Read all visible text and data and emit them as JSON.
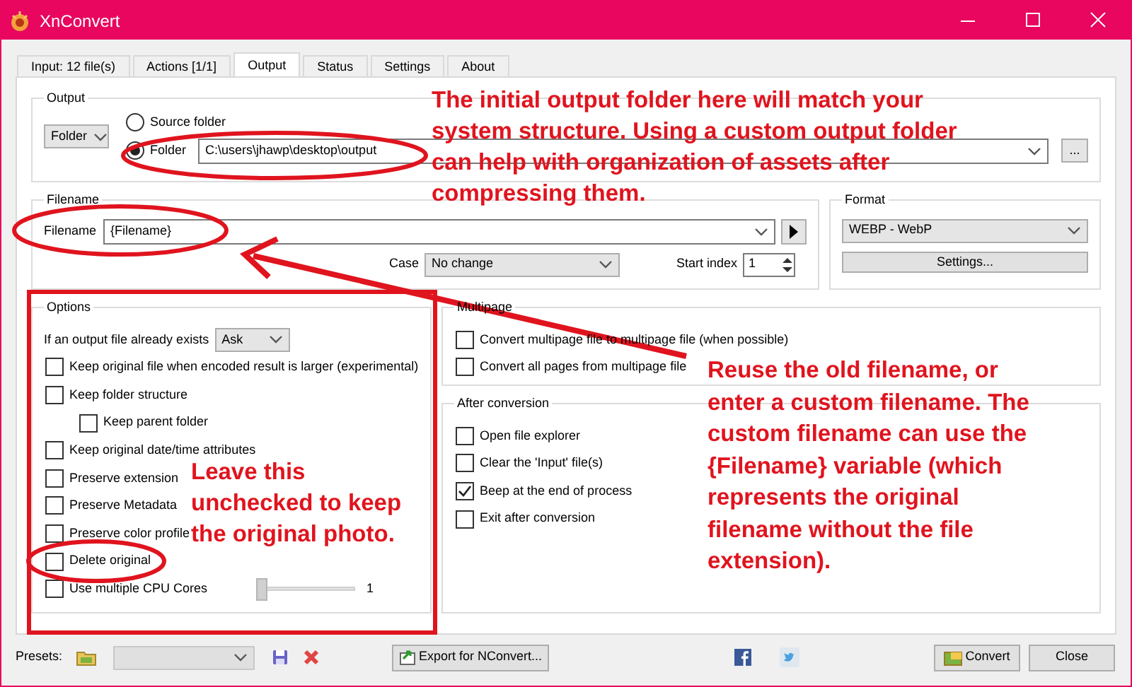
{
  "window": {
    "title": "XnConvert"
  },
  "tabs": [
    {
      "label": "Input: 12 file(s)",
      "selected": false
    },
    {
      "label": "Actions [1/1]",
      "selected": false
    },
    {
      "label": "Output",
      "selected": true
    },
    {
      "label": "Status",
      "selected": false
    },
    {
      "label": "Settings",
      "selected": false
    },
    {
      "label": "About",
      "selected": false
    }
  ],
  "output": {
    "title": "Output",
    "mode": "Folder",
    "radios": [
      {
        "label": "Source folder",
        "selected": false
      },
      {
        "label": "Folder",
        "selected": true
      }
    ],
    "path": "C:\\users\\jhawp\\desktop\\output",
    "browse": "..."
  },
  "filename": {
    "title": "Filename",
    "label": "Filename",
    "value": "{Filename}",
    "case_label": "Case",
    "case_value": "No change",
    "start_label": "Start index",
    "start_value": "1"
  },
  "format": {
    "title": "Format",
    "value": "WEBP - WebP",
    "button": "Settings..."
  },
  "options": {
    "title": "Options",
    "exists_label": "If an output file already exists",
    "exists_value": "Ask",
    "items": [
      {
        "kind": "checkbox",
        "label": "Keep original file when encoded result is larger (experimental)",
        "checked": false
      },
      {
        "kind": "checkbox",
        "label": "Keep folder structure",
        "checked": false,
        "children": [
          {
            "kind": "checkbox",
            "label": "Keep parent folder",
            "checked": false
          }
        ]
      },
      {
        "kind": "checkbox",
        "label": "Keep original date/time attributes",
        "checked": false
      },
      {
        "kind": "checkbox",
        "label": "Preserve extension",
        "checked": false
      },
      {
        "kind": "checkbox",
        "label": "Preserve Metadata",
        "checked": false
      },
      {
        "kind": "checkbox",
        "label": "Preserve color profile",
        "checked": false
      },
      {
        "kind": "checkbox",
        "label": "Delete original",
        "checked": false
      },
      {
        "kind": "slider",
        "label": "Use multiple CPU Cores",
        "checked": false,
        "level": 0,
        "reading": "1"
      }
    ]
  },
  "multipage": {
    "title": "Multipage",
    "items": [
      {
        "kind": "checkbox",
        "label": "Convert multipage file to multipage file (when possible)",
        "checked": false
      },
      {
        "kind": "checkbox",
        "label": "Convert all pages from multipage file",
        "checked": false
      }
    ]
  },
  "after_conversion": {
    "title": "After conversion",
    "items": [
      {
        "kind": "checkbox",
        "label": "Open file explorer",
        "checked": false
      },
      {
        "kind": "checkbox",
        "label": "Clear the 'Input' file(s)",
        "checked": false
      },
      {
        "kind": "checkbox",
        "label": "Beep at the end of process",
        "checked": true
      },
      {
        "kind": "checkbox",
        "label": "Exit after conversion",
        "checked": false
      }
    ]
  },
  "footer": {
    "presets_label": "Presets:",
    "export": "Export for NConvert...",
    "convert": "Convert",
    "close": "Close"
  },
  "annotations": [
    {
      "kind": "note",
      "lines": [
        "The initial output folder here will match your",
        "system structure. Using a custom output folder",
        "can help with organization of assets after",
        "compressing them."
      ]
    },
    {
      "kind": "note",
      "lines": [
        "Reuse the old filename, or",
        "enter a custom filename. The",
        "custom filename can use the",
        "{Filename} variable (which",
        "represents the original",
        "filename without the file",
        "extension)."
      ]
    },
    {
      "kind": "note",
      "lines": [
        "Leave this",
        "unchecked to keep",
        "the original photo."
      ]
    }
  ]
}
